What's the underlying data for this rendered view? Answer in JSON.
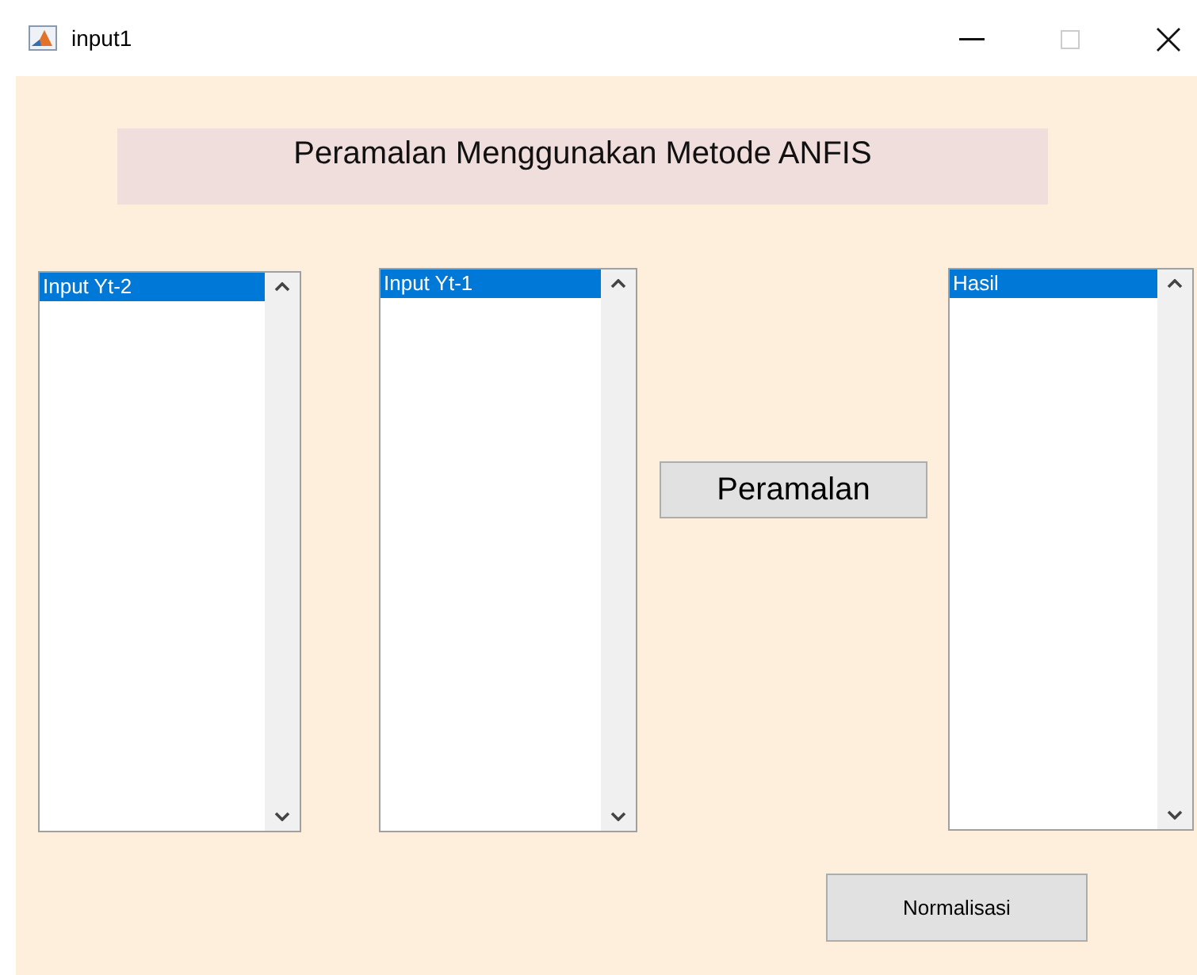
{
  "window": {
    "title": "input1",
    "maximize_disabled": true
  },
  "heading": "Peramalan Menggunakan Metode ANFIS",
  "listboxes": [
    {
      "items": [
        {
          "label": "Input Yt-2",
          "selected": true
        }
      ]
    },
    {
      "items": [
        {
          "label": "Input Yt-1",
          "selected": true
        }
      ]
    },
    {
      "items": [
        {
          "label": "Hasil",
          "selected": true
        }
      ]
    }
  ],
  "buttons": [
    {
      "label": "Peramalan",
      "kind": "large"
    },
    {
      "label": "Normalisasi",
      "kind": "small"
    }
  ]
}
